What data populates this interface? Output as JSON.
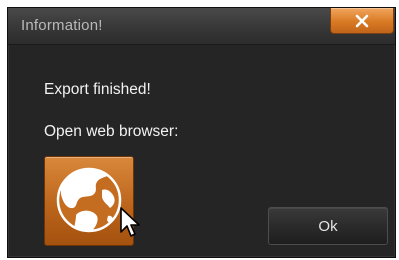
{
  "dialog": {
    "title": "Information!",
    "close_glyph": "✕",
    "message": "Export finished!",
    "prompt": "Open web browser:",
    "browser_icon": "globe-icon",
    "ok_label": "Ok"
  },
  "colors": {
    "accent": "#d97a24",
    "background": "#252525",
    "text": "#f2f2f2"
  }
}
